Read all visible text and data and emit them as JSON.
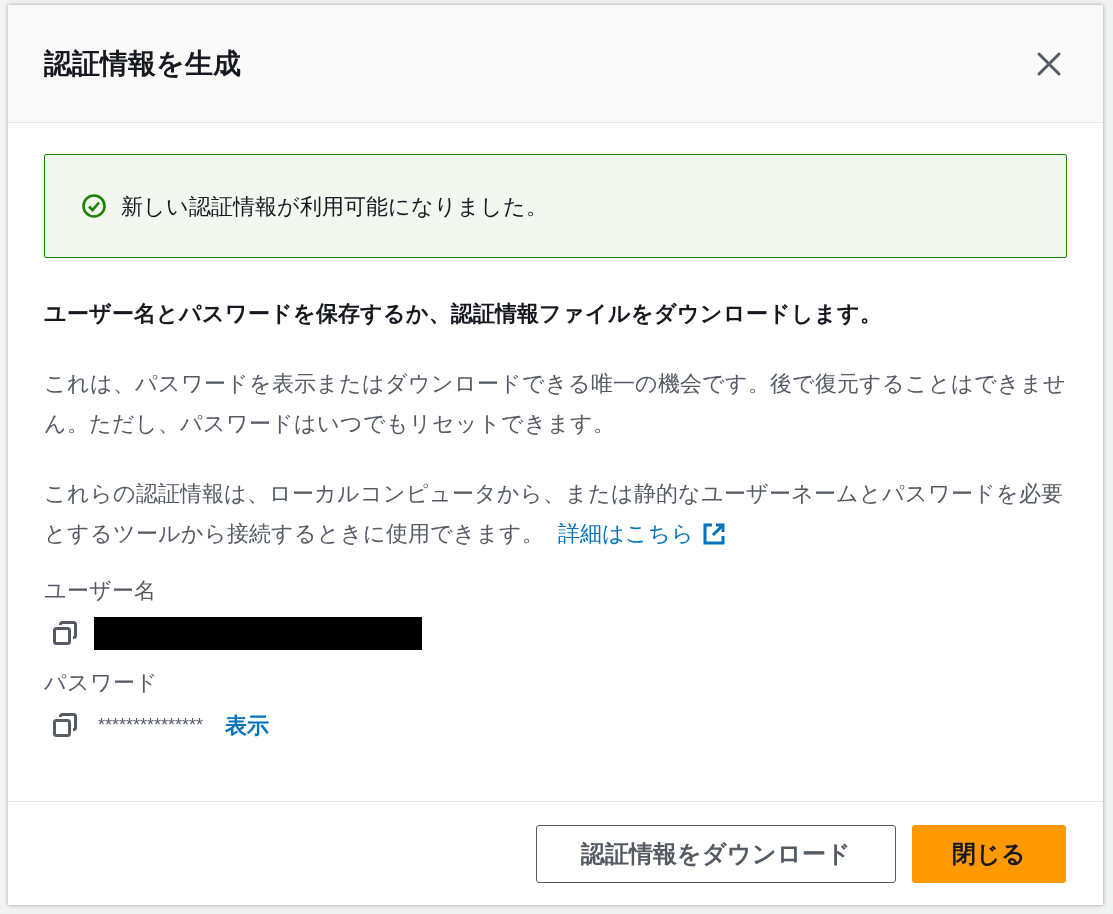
{
  "dialog": {
    "title": "認証情報を生成"
  },
  "alert": {
    "kind": "success",
    "message": "新しい認証情報が利用可能になりました。"
  },
  "heading": "ユーザー名とパスワードを保存するか、認証情報ファイルをダウンロードします。",
  "paragraphs": [
    {
      "text": "これは、パスワードを表示またはダウンロードできる唯一の機会です。後で復元することはできません。ただし、パスワードはいつでもリセットできます。"
    },
    {
      "text": "これらの認証情報は、ローカルコンピュータから、または静的なユーザーネームとパスワードを必要とするツールから接続するときに使用できます。",
      "link": "詳細はこちら"
    }
  ],
  "fields": [
    {
      "label": "ユーザー名",
      "kind": "redacted"
    },
    {
      "label": "パスワード",
      "kind": "masked",
      "value": "***************",
      "action": "表示"
    }
  ],
  "buttons": [
    {
      "label": "認証情報をダウンロード",
      "kind": "secondary"
    },
    {
      "label": "閉じる",
      "kind": "primary"
    }
  ]
}
